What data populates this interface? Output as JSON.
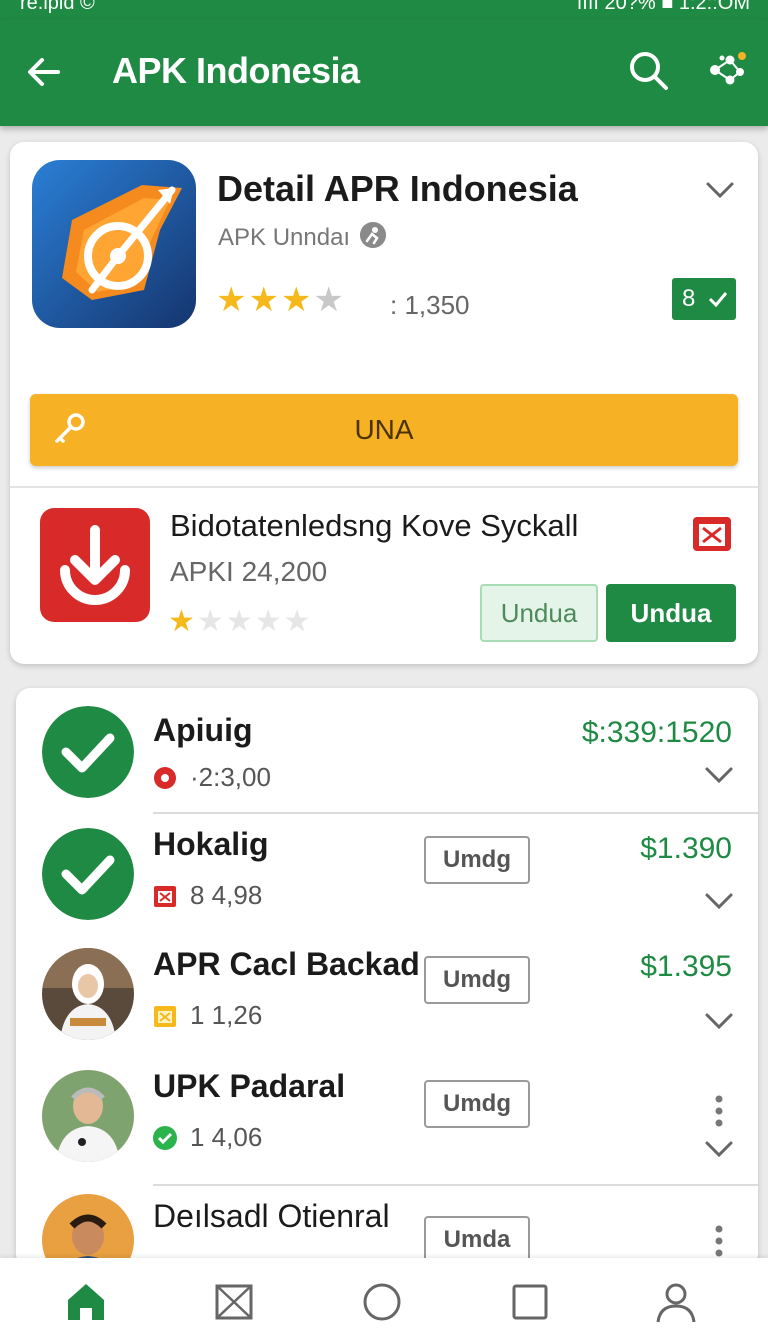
{
  "status_bar": {
    "left_text": "re.ipid ©",
    "right_text": "ıııı 20?% ■ 1:2::OM"
  },
  "app_bar": {
    "title": "APK Indonesia",
    "back_icon": "back-arrow-icon",
    "search_icon": "search-icon",
    "share_icon": "share-icon"
  },
  "detail": {
    "title": "Detail APR Indonesia",
    "developer": "APK Unndaı",
    "stars_on": "★★★",
    "stars_off": "★",
    "rating_count": ": 1,350",
    "version_badge": "8",
    "action_button": "UNA"
  },
  "suggestion": {
    "title": "Bidotatenledsng Kove Syckall",
    "subtitle": "APKI 24,200",
    "stars_on": "★",
    "stars_off": "★★★★",
    "secondary_button": "Undua",
    "primary_button": "Undua"
  },
  "list": [
    {
      "name": "Apiuig",
      "meta": "·2:3,00",
      "price": "$:339:1520",
      "button": ""
    },
    {
      "name": "Hokalig",
      "meta": "8 4,98",
      "price": "$1.390",
      "button": "Umdg"
    },
    {
      "name": "APR Cacl Backad",
      "meta": "1 1,26",
      "price": "$1.395",
      "button": "Umdg"
    },
    {
      "name": "UPK Padaral",
      "meta": "1 4,06",
      "price": "",
      "button": "Umdg"
    },
    {
      "name": "Deılsadl Otienral",
      "meta": "",
      "price": "",
      "button": "Umda"
    }
  ],
  "bottom_nav": [
    "home-icon",
    "box-icon",
    "circle-icon",
    "square-icon",
    "profile-icon"
  ],
  "colors": {
    "primary": "#1f8a43",
    "accent": "#f6b125",
    "danger": "#d92a2a"
  }
}
